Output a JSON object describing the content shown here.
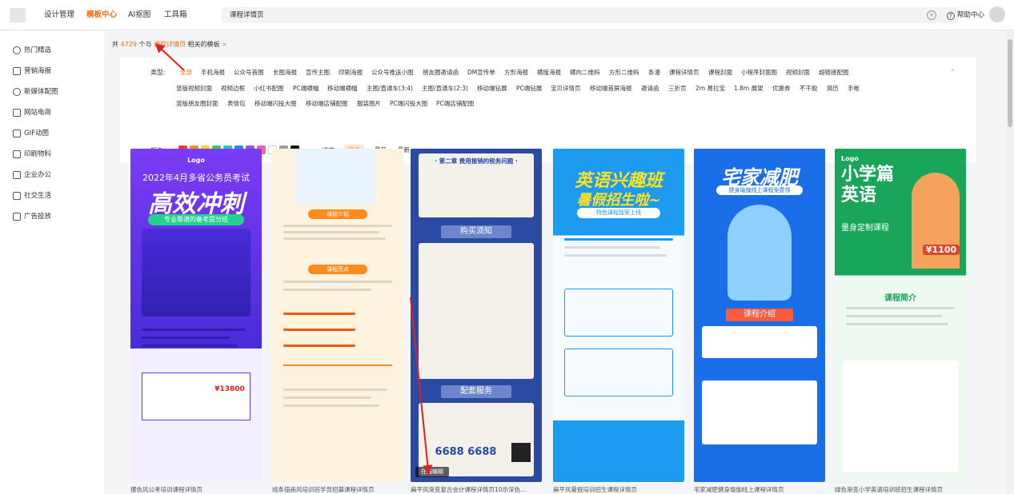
{
  "topbar": {
    "nav": [
      "设计管理",
      "模板中心",
      "AI抠图",
      "工具箱"
    ],
    "search_value": "课程详情页",
    "help_label": "帮助中心"
  },
  "sidebar": {
    "items": [
      "热门精选",
      "营销海报",
      "新媒体配图",
      "网站电商",
      "GIF动图",
      "印刷物料",
      "企业办公",
      "社交生活",
      "广告投放"
    ]
  },
  "results": {
    "prefix": "共",
    "count": "4729",
    "mid": "个与",
    "keyword": "课程详情页",
    "suffix": "相关的模板",
    "close": "×"
  },
  "filter": {
    "type_label": "类型:",
    "type_tags_row1": [
      "全部",
      "手机海报",
      "公众号首图",
      "长图海报",
      "宣传主图",
      "印刷海报",
      "公众号推送小图",
      "朋友圈邀请函",
      "DM宣传单",
      "方形海报",
      "横版海报",
      "横向二维码",
      "方形二维码",
      "条漫",
      "课程详情页",
      "课程封面",
      "小程序封面图",
      "视频封面",
      "超链接配图"
    ],
    "type_tags_row2": [
      "竖版视频封面",
      "视频边框",
      "小红书配图",
      "PC端横幅",
      "移动端横幅",
      "主图/直通车(3:4)",
      "主图/直通车(2:3)",
      "移动端钻展",
      "PC端钻展",
      "宝贝详情页",
      "移动端首屏海报",
      "邀请函",
      "三折页",
      "2m 易拉宝",
      "1.8m 展架",
      "优惠券",
      "不干胶",
      "简历",
      "手帐"
    ],
    "type_tags_row3": [
      "竖版朋友圈封面",
      "表情包",
      "移动端闪投大图",
      "移动端店铺配图",
      "服装图片",
      "PC端闪投大图",
      "PC端店铺配图"
    ],
    "color_label": "颜色:",
    "colors": [
      "#ff3333",
      "#ff8a1e",
      "#ffd21f",
      "#2fcf5a",
      "#23c7c9",
      "#2f80ff",
      "#9b51e0",
      "#ff5ca8",
      "#ffffff",
      "#9e9e9e",
      "#111111"
    ],
    "sort_label": "排序:",
    "sort_options": [
      "综合",
      "最热",
      "最新"
    ],
    "active_sort": "综合"
  },
  "cards": [
    {
      "caption": "撞色风公考培训课程详情页",
      "title": "高效冲刺",
      "subtitle": "专业靠谱的备考提分班",
      "top": "2022年4月多省公务员考试",
      "logo": "Logo",
      "bg": "#6b3cf0",
      "price": "¥13800"
    },
    {
      "caption": "线条插画风培训班学员招募课程详情页",
      "title": "课程介绍",
      "subtitle": "课程亮点",
      "top": "",
      "logo": "",
      "bg": "#fdf3df",
      "price": ""
    },
    {
      "caption": "扁平风渐变复古会计课程详情页10示深色...",
      "title": "购买须知",
      "subtitle": "配套服务",
      "top": "· 第二章 费用报销的税务问题 ·",
      "logo": "",
      "bg": "#2a4aa3",
      "price": "6688 6688",
      "overlay": "在线编辑"
    },
    {
      "caption": "扁平风暑假培训招生课程详情页",
      "title": "英语兴趣班",
      "subtitle": "暑假招生啦~",
      "top": "特色课程独家上线",
      "logo": "",
      "bg": "#1d9bf0",
      "price": ""
    },
    {
      "caption": "宅家减肥健身瑜伽线上课程详情页",
      "title": "宅家减肥",
      "subtitle": "健身瑜伽线上课程免费领",
      "top": "课程介绍",
      "logo": "",
      "bg": "#1a6ee8",
      "price": ""
    },
    {
      "caption": "绿色渐变小学英语培训班招生课程详情页",
      "title": "小学篇 英语",
      "subtitle": "量身定制课程",
      "top": "课程简介",
      "logo": "Logo",
      "bg": "#19a55a",
      "price": "¥1100"
    }
  ]
}
